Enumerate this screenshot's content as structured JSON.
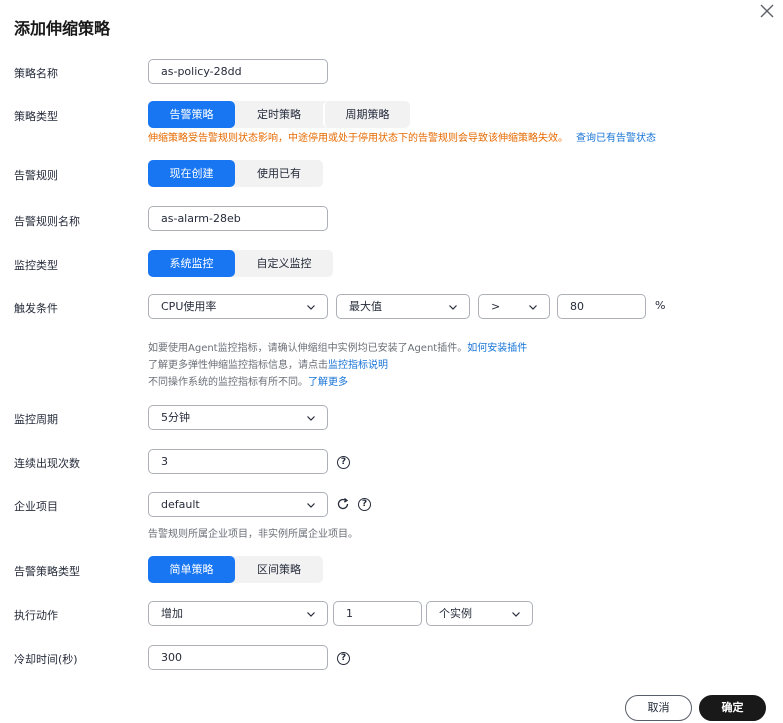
{
  "dialog": {
    "title": "添加伸缩策略",
    "cancel_label": "取消",
    "confirm_label": "确定"
  },
  "policy_name": {
    "label": "策略名称",
    "value": "as-policy-28dd"
  },
  "policy_type": {
    "label": "策略类型",
    "options": [
      "告警策略",
      "定时策略",
      "周期策略"
    ],
    "selected": "告警策略",
    "warning": "伸缩策略受告警规则状态影响，中途停用或处于停用状态下的告警规则会导致该伸缩策略失效。",
    "warning_link": "查询已有告警状态"
  },
  "alarm_rule": {
    "label": "告警规则",
    "options": [
      "现在创建",
      "使用已有"
    ],
    "selected": "现在创建"
  },
  "alarm_rule_name": {
    "label": "告警规则名称",
    "value": "as-alarm-28eb"
  },
  "monitor_type": {
    "label": "监控类型",
    "options": [
      "系统监控",
      "自定义监控"
    ],
    "selected": "系统监控"
  },
  "trigger": {
    "label": "触发条件",
    "metric": "CPU使用率",
    "aggregation": "最大值",
    "operator": ">",
    "threshold": "80",
    "unit": "%",
    "hint1": "如要使用Agent监控指标，请确认伸缩组中实例均已安装了Agent插件。",
    "hint1_link": "如何安装插件",
    "hint2": "了解更多弹性伸缩监控指标信息，请点击",
    "hint2_link": "监控指标说明",
    "hint3": "不同操作系统的监控指标有所不同。",
    "hint3_link": "了解更多"
  },
  "monitor_period": {
    "label": "监控周期",
    "value": "5分钟"
  },
  "consecutive": {
    "label": "连续出现次数",
    "value": "3"
  },
  "enterprise_project": {
    "label": "企业项目",
    "value": "default",
    "hint": "告警规则所属企业项目，非实例所属企业项目。"
  },
  "alarm_policy_type": {
    "label": "告警策略类型",
    "options": [
      "简单策略",
      "区间策略"
    ],
    "selected": "简单策略"
  },
  "action": {
    "label": "执行动作",
    "operation": "增加",
    "count": "1",
    "unit": "个实例"
  },
  "cooldown": {
    "label": "冷却时间(秒)",
    "value": "300"
  },
  "icons": [
    "close-icon",
    "chevron-down-icon",
    "help-icon",
    "refresh-icon"
  ],
  "colors": {
    "primary": "#1876f2",
    "warning": "#e56a00",
    "link": "#1673d6",
    "confirm": "#191919"
  }
}
